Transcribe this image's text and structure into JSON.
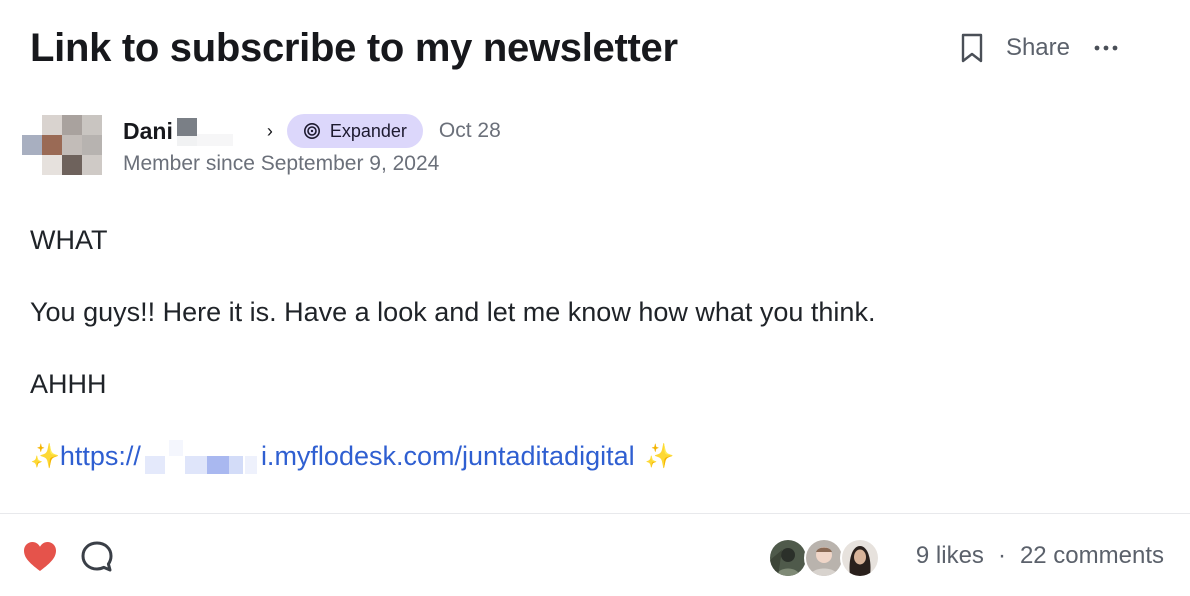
{
  "post": {
    "title": "Link to subscribe to my newsletter",
    "share_label": "Share",
    "author": {
      "first_name": "Dani",
      "badge": "Expander",
      "member_since": "Member since September 9, 2024"
    },
    "date": "Oct 28",
    "body": {
      "line1": "WHAT",
      "line2": "You guys!! Here it is. Have a look and let me know how what you think.",
      "line3": "AHHH",
      "link_prefix": "https://",
      "link_suffix": "i.myflodesk.com/juntaditadigital",
      "sparkle": "✨"
    }
  },
  "footer": {
    "likes": "9 likes",
    "separator": "·",
    "comments": "22 comments"
  },
  "colors": {
    "link": "#2f5fd1",
    "heart": "#e5534b",
    "badge_bg": "#dcd7fb"
  },
  "icons": [
    "bookmark-icon",
    "more-icon",
    "badge-spiral-icon",
    "heart-icon",
    "comment-icon"
  ]
}
